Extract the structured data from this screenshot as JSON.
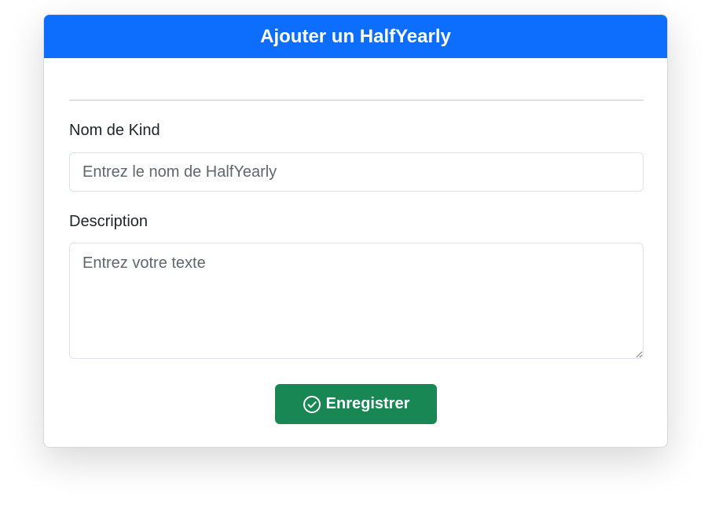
{
  "form": {
    "title": "Ajouter un HalfYearly",
    "name_label": "Nom de Kind",
    "name_placeholder": "Entrez le nom de HalfYearly",
    "name_value": "",
    "description_label": "Description",
    "description_placeholder": "Entrez votre texte",
    "description_value": "",
    "save_label": "Enregistrer",
    "save_icon": "check-circle-icon"
  },
  "colors": {
    "header": "#0d6efd",
    "save_button": "#198754"
  }
}
